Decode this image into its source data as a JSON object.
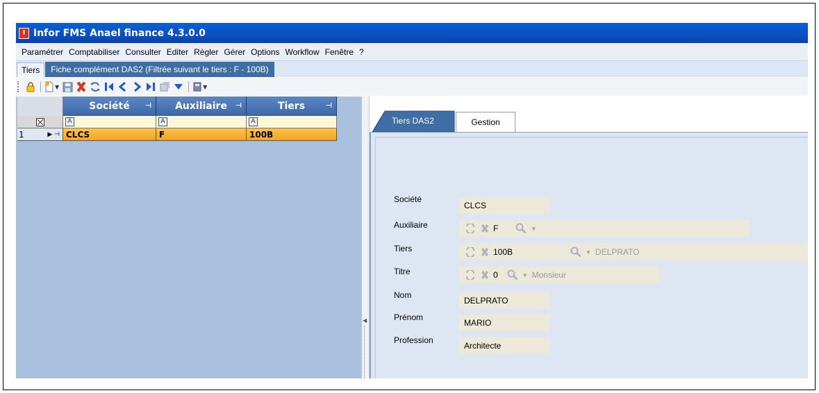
{
  "window": {
    "title": "Infor FMS Anael finance 4.3.0.0",
    "icon_letter": "I"
  },
  "menu": [
    "Paramétrer",
    "Comptabiliser",
    "Consulter",
    "Editer",
    "Règler",
    "Gérer",
    "Options",
    "Workflow",
    "Fenêtre",
    "?"
  ],
  "doc_tabs": {
    "tiers_label": "Tiers",
    "fiche_label": "Fiche complément DAS2 (Filtrée suivant le tiers : F - 100B)"
  },
  "toolbar": {
    "icons": [
      "lock-icon",
      "new-record-icon",
      "save-icon",
      "delete-icon",
      "refresh-icon",
      "first-record-icon",
      "previous-record-icon",
      "next-record-icon",
      "last-record-icon",
      "export-icon",
      "filter-icon",
      "print-icon"
    ]
  },
  "grid": {
    "columns": [
      "Société",
      "Auxiliaire",
      "Tiers"
    ],
    "filter_glyph": "A",
    "rows": [
      {
        "index": "1",
        "societe": "CLCS",
        "auxiliaire": "F",
        "tiers": "100B"
      }
    ]
  },
  "detail_tabs": {
    "tab1": "Tiers DAS2",
    "tab2": "Gestion"
  },
  "form": {
    "societe": {
      "label": "Société",
      "value": "CLCS"
    },
    "auxiliaire": {
      "label": "Auxiliaire",
      "value": "F"
    },
    "tiers": {
      "label": "Tiers",
      "value": "100B",
      "lookup": "DELPRATO"
    },
    "titre": {
      "label": "Titre",
      "value": "0",
      "lookup": "Monsieur"
    },
    "nom": {
      "label": "Nom",
      "value": "DELPRATO"
    },
    "prenom": {
      "label": "Prénom",
      "value": "MARIO"
    },
    "profession": {
      "label": "Profession",
      "value": "Architecte"
    }
  },
  "colors": {
    "title_bar": "#0b4fc0",
    "grid_header": "#4a74b6",
    "selected_row": "#f6ad2f",
    "left_panel": "#a9c0df",
    "field_bg": "#ece9d8"
  }
}
